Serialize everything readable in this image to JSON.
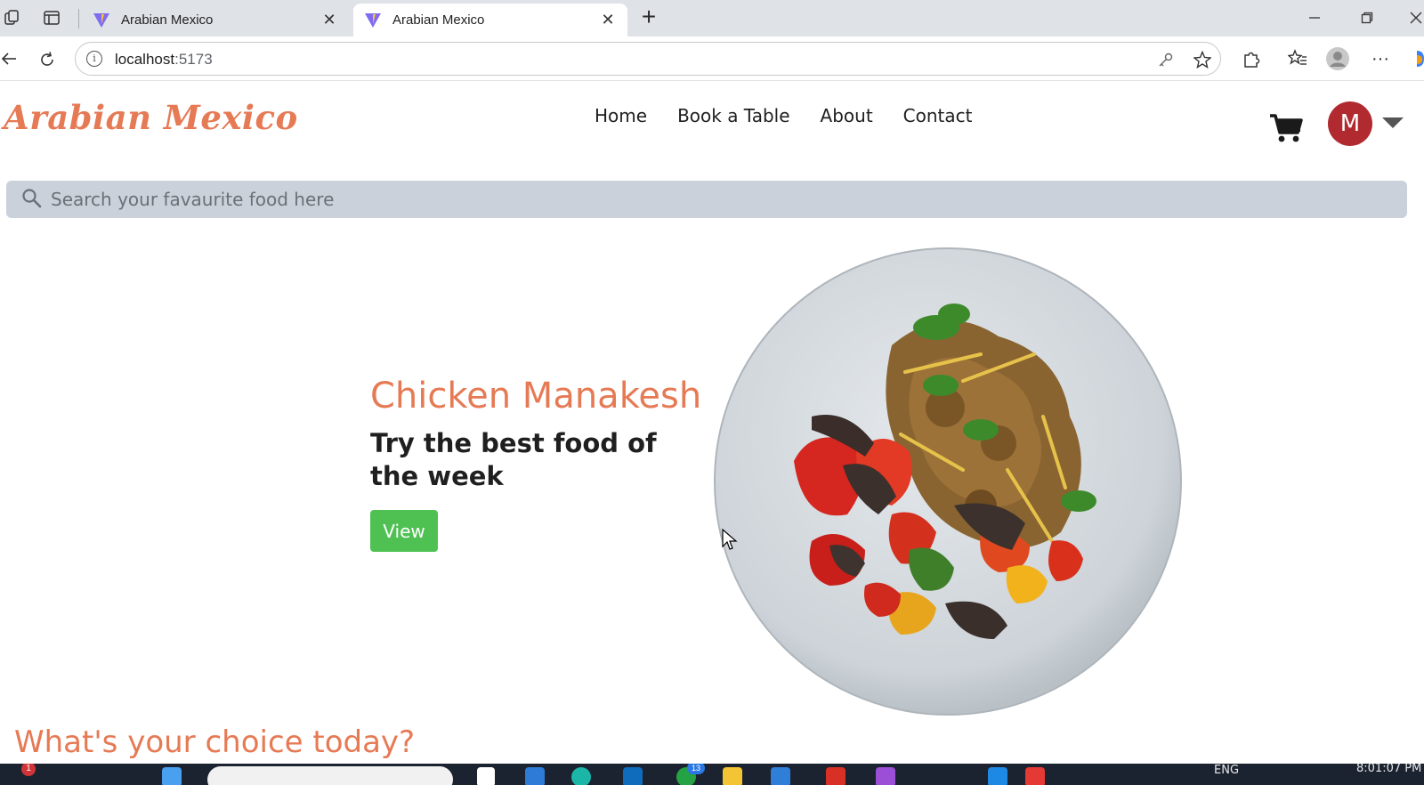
{
  "browser": {
    "tabs": [
      {
        "title": "Arabian Mexico",
        "active": false
      },
      {
        "title": "Arabian Mexico",
        "active": true
      }
    ],
    "new_tab_label": "+",
    "address": {
      "host": "localhost",
      "port": ":5173"
    }
  },
  "site": {
    "brand": "Arabian Mexico",
    "nav": [
      "Home",
      "Book a Table",
      "About",
      "Contact"
    ],
    "avatar_initial": "M",
    "search_placeholder": "Search your favaurite food here"
  },
  "hero": {
    "title": "Chicken Manakesh",
    "subtitle": "Try the best food of the week",
    "button": "View"
  },
  "section": {
    "heading": "What's your choice today?"
  },
  "taskbar": {
    "notification_count": "1",
    "badge_count": "13",
    "language": "ENG",
    "time": "8:01:07 PM"
  },
  "colors": {
    "accent": "#e67a55",
    "button": "#4fc153",
    "avatar": "#b02a30",
    "search_bg": "#cbd1da"
  }
}
